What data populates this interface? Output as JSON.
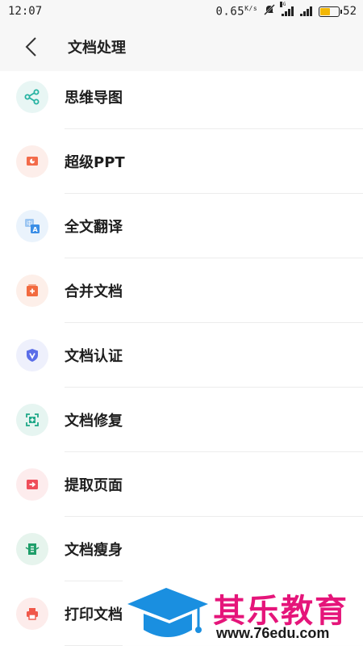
{
  "status": {
    "time": "12:07",
    "speed_value": "0.65",
    "speed_unit": "K/s",
    "network_tag": "4G",
    "battery_level": "52"
  },
  "header": {
    "title": "文档处理"
  },
  "items": [
    {
      "label": "思维导图",
      "icon": "mindmap-icon",
      "color": "#27b3a2",
      "bg": "#e8f6f4"
    },
    {
      "label": "超级PPT",
      "icon": "ppt-icon",
      "color": "#f36b4a",
      "bg": "#fdeeea"
    },
    {
      "label": "全文翻译",
      "icon": "translate-icon",
      "color": "#3a8ee6",
      "bg": "#eaf3fc"
    },
    {
      "label": "合并文档",
      "icon": "merge-icon",
      "color": "#f26a3f",
      "bg": "#fdefe9"
    },
    {
      "label": "文档认证",
      "icon": "shield-icon",
      "color": "#5b6ee8",
      "bg": "#eef0fc"
    },
    {
      "label": "文档修复",
      "icon": "repair-icon",
      "color": "#20a888",
      "bg": "#e6f5f1"
    },
    {
      "label": "提取页面",
      "icon": "extract-icon",
      "color": "#ef4d5a",
      "bg": "#fdeced"
    },
    {
      "label": "文档瘦身",
      "icon": "slim-icon",
      "color": "#1f9e6a",
      "bg": "#e6f4ed"
    },
    {
      "label": "打印文档",
      "icon": "printer-icon",
      "color": "#f0584a",
      "bg": "#fdeceb"
    }
  ],
  "watermark": {
    "name": "其乐教育",
    "url": "www.76edu.com"
  }
}
